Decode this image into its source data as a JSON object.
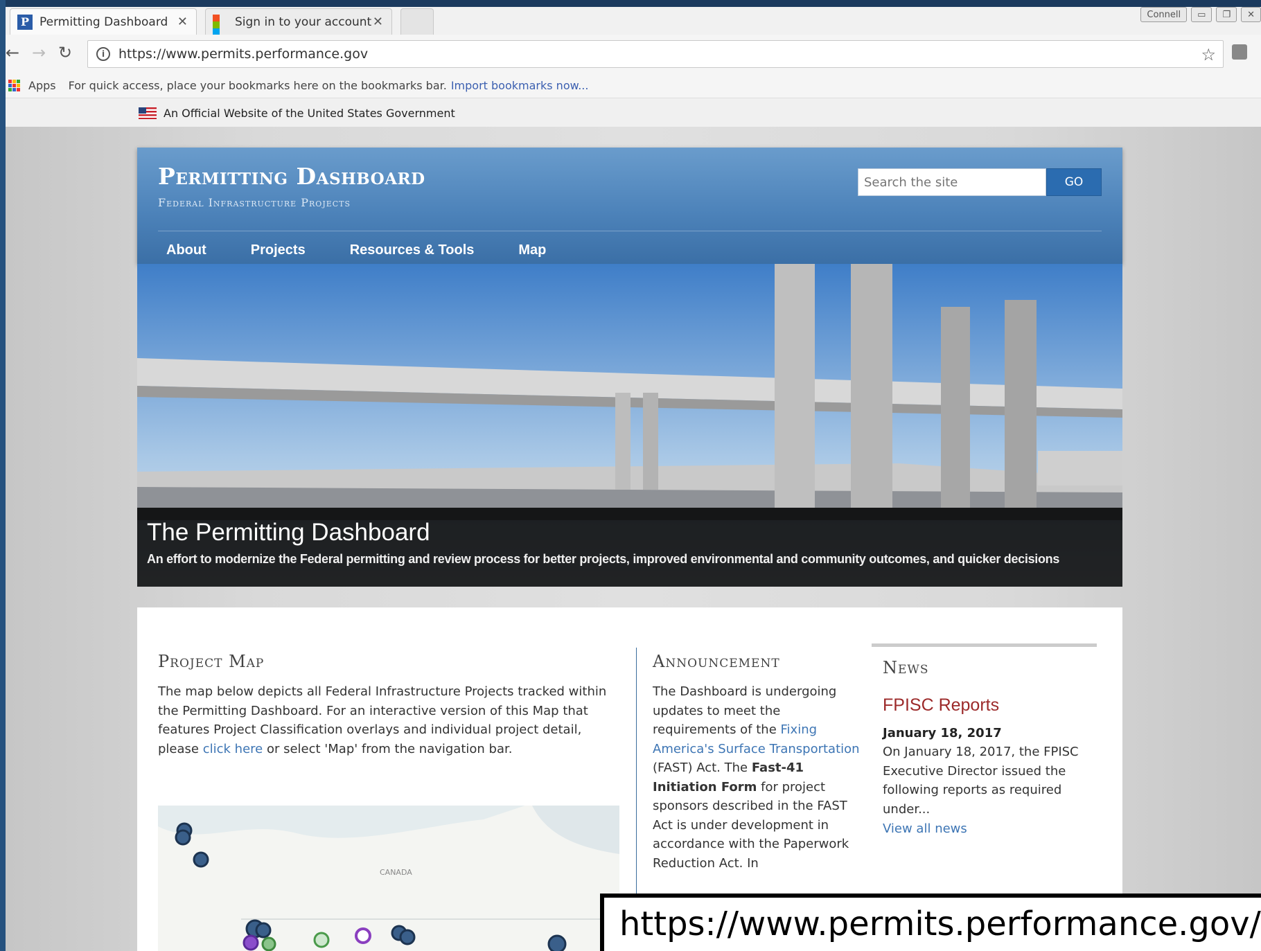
{
  "browser": {
    "tabs": [
      {
        "label": "Permitting Dashboard",
        "favicon": "P"
      },
      {
        "label": "Sign in to your account"
      }
    ],
    "window_user": "Connell",
    "url": "https://www.permits.performance.gov",
    "bookmarks_apps": "Apps",
    "bookmarks_hint": "For quick access, place your bookmarks here on the bookmarks bar.",
    "bookmarks_import": "Import bookmarks now..."
  },
  "gov_banner": "An Official Website of the United States Government",
  "header": {
    "title": "Permitting Dashboard",
    "subtitle": "Federal Infrastructure Projects",
    "search_placeholder": "Search the site",
    "search_button": "GO",
    "nav": [
      "About",
      "Projects",
      "Resources & Tools",
      "Map"
    ]
  },
  "hero": {
    "title": "The Permitting Dashboard",
    "subtitle": "An effort to modernize the Federal permitting and review process for better projects, improved environmental and community outcomes, and quicker decisions"
  },
  "project_map": {
    "title": "Project Map",
    "text_before_link": "The map below depicts all Federal Infrastructure Projects tracked within the Permitting Dashboard. For an interactive version of this Map that features Project Classification overlays and individual project detail, please",
    "link": "click here",
    "text_after_link": "or select 'Map' from the navigation bar.",
    "map_label": "CANADA"
  },
  "announcement": {
    "title": "Announcement",
    "p1": "The Dashboard is undergoing updates to meet the requirements of the",
    "link": "Fixing America's Surface Transportation",
    "p2": "(FAST) Act. The",
    "bold": "Fast-41 Initiation Form",
    "p3": "for project sponsors described in the FAST Act is under development in accordance with the Paperwork Reduction Act.  In"
  },
  "news": {
    "title": "News",
    "headline": "FPISC Reports",
    "date": "January 18, 2017",
    "body": "On January 18, 2017, the FPISC Executive Director issued the following reports as required under...",
    "link": "View all news"
  },
  "overlay_url": "https://www.permits.performance.gov/",
  "colors": {
    "frame": "#1e3d62",
    "header_blue": "#4d83ba",
    "go_button": "#2b6cb0",
    "news_headline": "#9c2a2a",
    "link": "#3d75b4"
  }
}
